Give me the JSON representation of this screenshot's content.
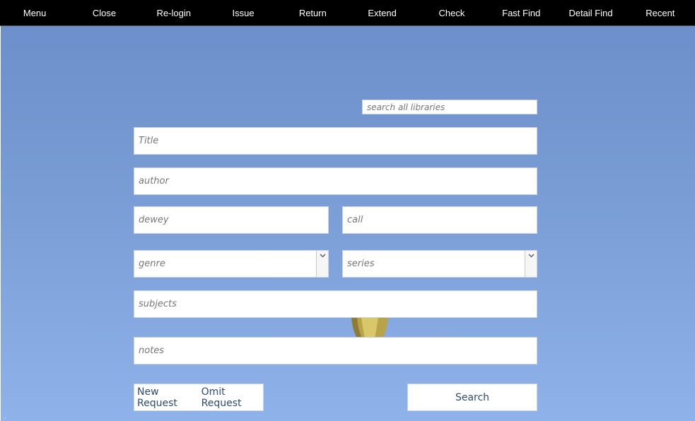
{
  "nav": {
    "items": [
      {
        "id": "menu",
        "label": "Menu"
      },
      {
        "id": "close",
        "label": "Close"
      },
      {
        "id": "relogin",
        "label": "Re-login"
      },
      {
        "id": "issue",
        "label": "Issue"
      },
      {
        "id": "return",
        "label": "Return"
      },
      {
        "id": "extend",
        "label": "Extend"
      },
      {
        "id": "check",
        "label": "Check"
      },
      {
        "id": "fast-find",
        "label": "Fast Find"
      },
      {
        "id": "detail-find",
        "label": "Detail Find"
      },
      {
        "id": "recent",
        "label": "Recent"
      }
    ]
  },
  "form": {
    "search_all_placeholder": "search all libraries",
    "title_placeholder": "Title",
    "author_placeholder": "author",
    "dewey_placeholder": "dewey",
    "call_placeholder": "call",
    "genre_selected": "genre",
    "series_selected": "series",
    "subjects_placeholder": "subjects",
    "notes_placeholder": "notes"
  },
  "actions": {
    "new_request": "New Request",
    "omit_request": "Omit Request",
    "search": "Search"
  },
  "icons": {
    "dropdown": "chevron-down-icon",
    "balloon": "hot-air-balloon-icon"
  },
  "colors": {
    "topbar": "#000000",
    "background_top": "#6d8fcb",
    "background_bottom": "#8fb2ea",
    "button_text": "#2d4a78"
  }
}
